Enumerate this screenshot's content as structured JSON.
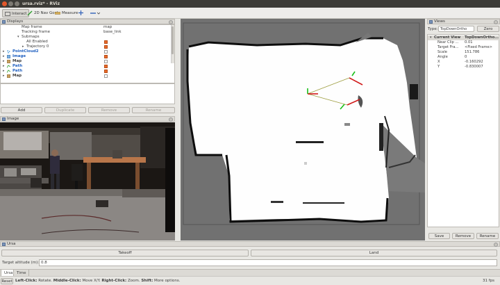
{
  "window": {
    "title": "ursa.rviz* - RViz"
  },
  "toolbar": {
    "interact": "Interact",
    "nav_goal": "2D Nav Goal",
    "measure": "Measure"
  },
  "displays": {
    "title": "Displays",
    "rows": [
      {
        "label": "Map frame",
        "value": "map"
      },
      {
        "label": "Tracking frame",
        "value": "base_link"
      },
      {
        "label": "Submaps",
        "value": ""
      },
      {
        "label": "All Enabled",
        "value": ""
      },
      {
        "label": "Trajectory 0",
        "value": ""
      },
      {
        "label": "PointCloud2",
        "value": ""
      },
      {
        "label": "Image",
        "value": ""
      },
      {
        "label": "Map",
        "value": ""
      },
      {
        "label": "Path",
        "value": ""
      },
      {
        "label": "Path",
        "value": ""
      },
      {
        "label": "Map",
        "value": ""
      }
    ],
    "buttons": {
      "add": "Add",
      "duplicate": "Duplicate",
      "remove": "Remove",
      "rename": "Rename"
    }
  },
  "image_panel": {
    "title": "Image"
  },
  "views": {
    "title": "Views",
    "type_label": "Type:",
    "type_value": "TopDownOrtho",
    "zero": "Zero",
    "rows": [
      {
        "key": "Current View",
        "value": "TopDownOrtho..."
      },
      {
        "key": "Near Clip ...",
        "value": "0.01"
      },
      {
        "key": "Target Fra...",
        "value": "<Fixed Frame>"
      },
      {
        "key": "Scale",
        "value": "151.786"
      },
      {
        "key": "Angle",
        "value": "0"
      },
      {
        "key": "X",
        "value": "-0.160292"
      },
      {
        "key": "Y",
        "value": "-0.830007"
      }
    ],
    "buttons": {
      "save": "Save",
      "remove": "Remove",
      "rename": "Rename"
    }
  },
  "ursa": {
    "title": "Ursa",
    "takeoff": "Takeoff",
    "land": "Land",
    "altitude_label": "Target altitude (m):",
    "altitude_value": "0.8"
  },
  "tabs": [
    "Ursa",
    "Time"
  ],
  "status": {
    "reset": "Reset",
    "left_click": "Left-Click:",
    "left_desc": " Rotate. ",
    "middle_click": "Middle-Click:",
    "middle_desc": " Move X/Y. ",
    "right_click": "Right-Click:",
    "right_desc": " Zoom. ",
    "shift": "Shift:",
    "shift_desc": " More options.",
    "fps": "31 fps"
  },
  "colors": {
    "accent_orange": "#e86a2b",
    "path_green": "#18c018",
    "path_red": "#d01818"
  }
}
